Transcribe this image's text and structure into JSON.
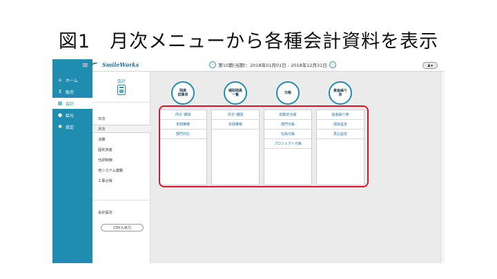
{
  "slide": {
    "title": "図1　月次メニューから各種会計資料を表示"
  },
  "nav": {
    "menu_icon": "menu-icon",
    "items": [
      {
        "label": "ホーム",
        "icon": "home-icon",
        "glyph": "⌂",
        "active": false
      },
      {
        "label": "販売",
        "icon": "cart-icon",
        "glyph": "⊻",
        "active": false
      },
      {
        "label": "会計",
        "icon": "calculator-icon",
        "glyph": "▦",
        "active": true
      },
      {
        "label": "給与",
        "icon": "money-bag-icon",
        "glyph": "●",
        "active": false
      },
      {
        "label": "設定",
        "icon": "gear-icon",
        "glyph": "✱",
        "active": false
      }
    ]
  },
  "header": {
    "brand": "SmileWorks",
    "period_text": "第10期(当期)：2018年01月01日 - 2018年12月31日",
    "prev_glyph": "‹",
    "next_glyph": "›",
    "user_glyph": "♟▾"
  },
  "sidebar": {
    "title": "会計",
    "items": [
      "日次",
      "月次",
      "決算",
      "固定資産",
      "仕訳制御",
      "他システム連動",
      "工事台帳"
    ],
    "active_index": 1,
    "settings_label": "会計設定",
    "csv_button": "CSV入出力"
  },
  "content": {
    "categories": [
      {
        "label": "残高\n試算表",
        "items": [
          "月次･期間",
          "年間推移",
          "部門対比"
        ]
      },
      {
        "label": "補助残高\n一覧",
        "items": [
          "月次･期間",
          "年間推移"
        ]
      },
      {
        "label": "元帳",
        "items": [
          "総勘定元帳",
          "部門元帳",
          "社員元帳",
          "プロジェクト元帳"
        ]
      },
      {
        "label": "資金繰り\n表",
        "items": [
          "資金繰り表",
          "項目設定",
          "見込設定"
        ]
      }
    ]
  },
  "colors": {
    "accent": "#1f8cb0",
    "highlight_frame": "#e0141e"
  }
}
